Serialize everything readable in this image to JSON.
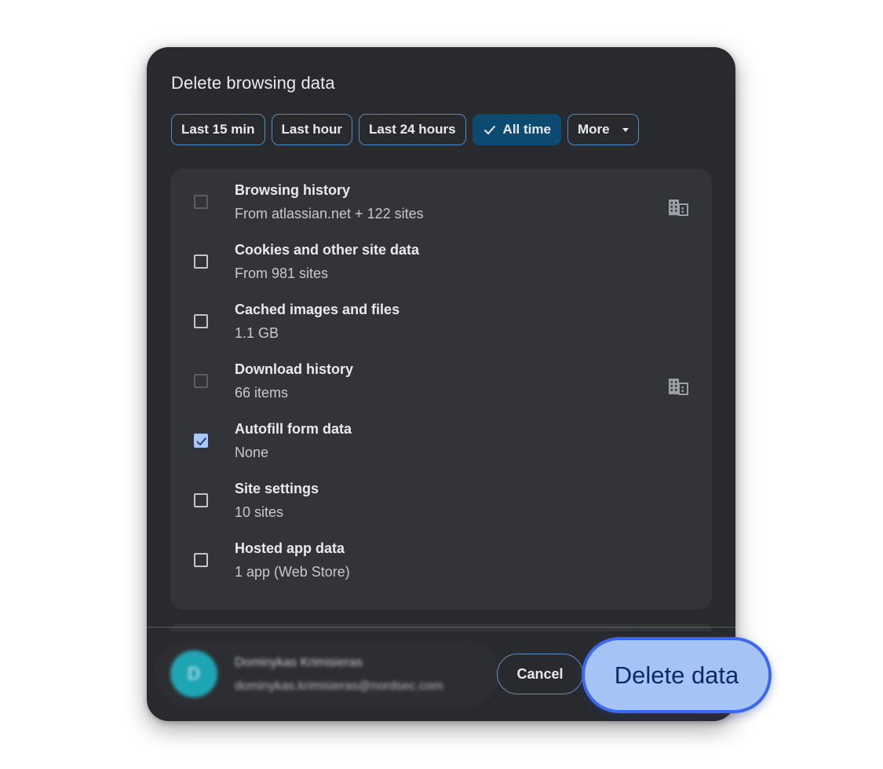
{
  "dialog": {
    "title": "Delete browsing data"
  },
  "time_ranges": [
    {
      "label": "Last 15 min",
      "selected": false
    },
    {
      "label": "Last hour",
      "selected": false
    },
    {
      "label": "Last 24 hours",
      "selected": false
    },
    {
      "label": "All time",
      "selected": true,
      "icon": "check-icon"
    },
    {
      "label": "More",
      "selected": false,
      "icon": "caret-down-icon"
    }
  ],
  "data_types": [
    {
      "label": "Browsing history",
      "detail": "From atlassian.net + 122 sites",
      "checked": false,
      "disabled": true,
      "managed_icon": "building-icon"
    },
    {
      "label": "Cookies and other site data",
      "detail": "From 981 sites",
      "checked": false,
      "disabled": false
    },
    {
      "label": "Cached images and files",
      "detail": "1.1 GB",
      "checked": false,
      "disabled": false
    },
    {
      "label": "Download history",
      "detail": "66 items",
      "checked": false,
      "disabled": true,
      "managed_icon": "building-icon"
    },
    {
      "label": "Autofill form data",
      "detail": "None",
      "checked": true,
      "disabled": false
    },
    {
      "label": "Site settings",
      "detail": "10 sites",
      "checked": false,
      "disabled": false
    },
    {
      "label": "Hosted app data",
      "detail": "1 app (Web Store)",
      "checked": false,
      "disabled": false
    }
  ],
  "account": {
    "avatar_initial": "D",
    "name": "Dominykas Krimisieras",
    "email": "dominykas.krimisieras@nordsec.com"
  },
  "footer": {
    "cancel_label": "Cancel",
    "delete_label": "Delete data"
  },
  "colors": {
    "dialog_background": "#292a2d",
    "card_background": "#333438",
    "chip_border": "#4a8ec9",
    "chip_selected": "#0c4a71",
    "checkbox_checked": "#a8c7fa",
    "delete_button": "#a6c3f6",
    "delete_button_border": "#3b67f5",
    "avatar": "#1ea5b3"
  }
}
